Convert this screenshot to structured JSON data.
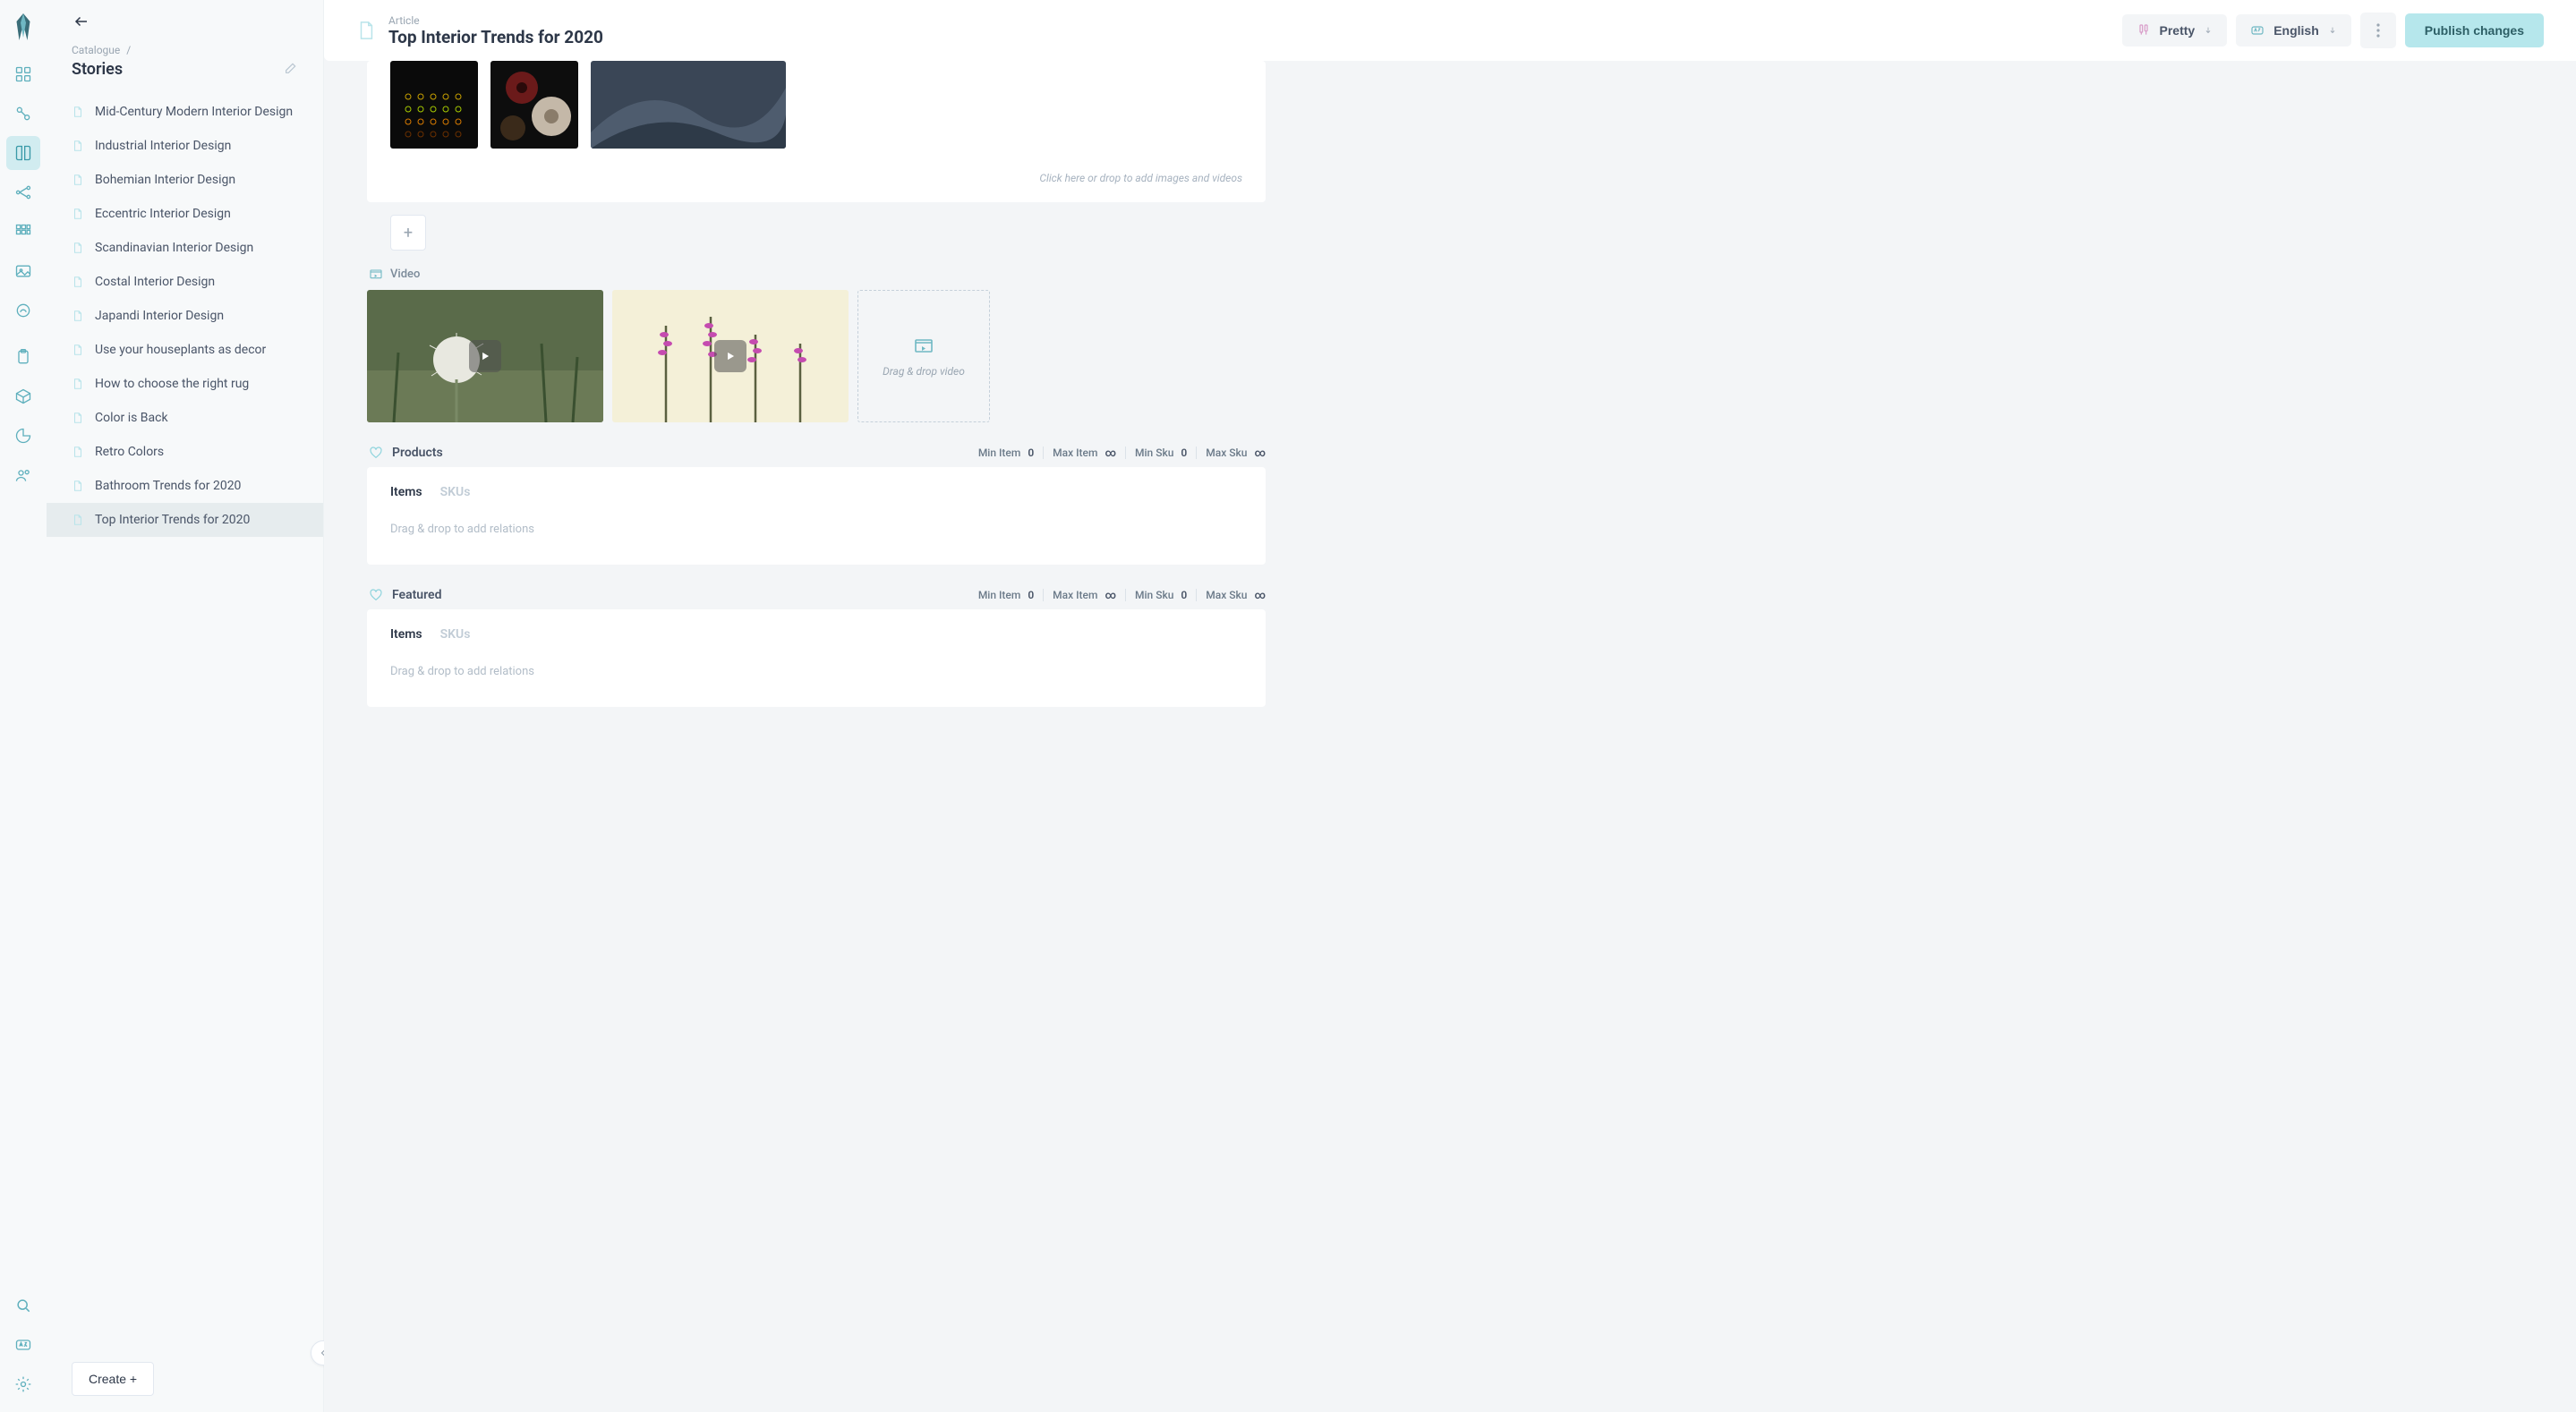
{
  "sidebar": {
    "breadcrumb_parent": "Catalogue",
    "breadcrumb_sep": "/",
    "title": "Stories",
    "items": [
      {
        "label": "Mid-Century Modern Interior Design"
      },
      {
        "label": "Industrial Interior Design"
      },
      {
        "label": "Bohemian Interior Design"
      },
      {
        "label": "Eccentric Interior Design"
      },
      {
        "label": "Scandinavian Interior Design"
      },
      {
        "label": "Costal Interior Design"
      },
      {
        "label": "Japandi Interior Design"
      },
      {
        "label": "Use your houseplants as decor"
      },
      {
        "label": "How to choose the right rug"
      },
      {
        "label": "Color is Back"
      },
      {
        "label": "Retro Colors"
      },
      {
        "label": "Bathroom Trends for 2020"
      },
      {
        "label": "Top Interior Trends for 2020"
      }
    ],
    "active_index": 12,
    "create_label": "Create +"
  },
  "topbar": {
    "kicker": "Article",
    "title": "Top Interior Trends for 2020",
    "view_mode": "Pretty",
    "language": "English",
    "publish": "Publish changes"
  },
  "blocks": {
    "image_hint": "Click here or drop to add images and videos",
    "add_block": "+",
    "video_label": "Video",
    "video_drop_hint": "Drag & drop video"
  },
  "relations": {
    "products": {
      "title": "Products",
      "stats": {
        "min_item_label": "Min Item",
        "min_item_value": "0",
        "max_item_label": "Max Item",
        "max_item_value": "∞",
        "min_sku_label": "Min Sku",
        "min_sku_value": "0",
        "max_sku_label": "Max Sku",
        "max_sku_value": "∞"
      },
      "tabs": {
        "items": "Items",
        "skus": "SKUs"
      },
      "drop_hint": "Drag & drop to add relations"
    },
    "featured": {
      "title": "Featured",
      "stats": {
        "min_item_label": "Min Item",
        "min_item_value": "0",
        "max_item_label": "Max Item",
        "max_item_value": "∞",
        "min_sku_label": "Min Sku",
        "min_sku_value": "0",
        "max_sku_label": "Max Sku",
        "max_sku_value": "∞"
      },
      "tabs": {
        "items": "Items",
        "skus": "SKUs"
      },
      "drop_hint": "Drag & drop to add relations"
    }
  }
}
